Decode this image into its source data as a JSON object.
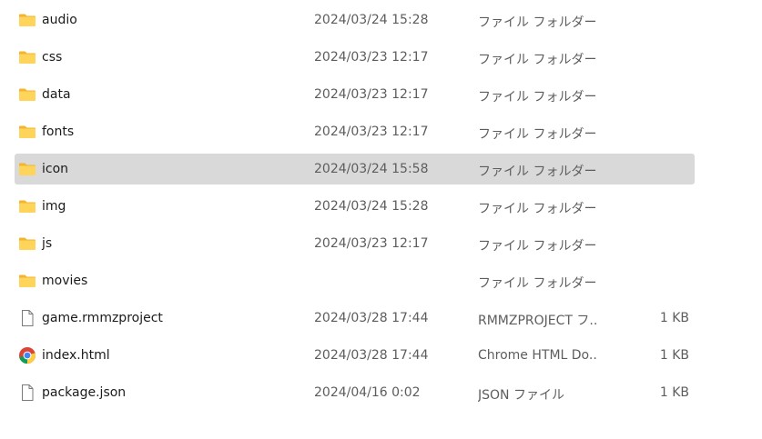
{
  "colors": {
    "folder": "#ffd45a",
    "folder_tab": "#f2b52b",
    "selected_row": "#d9d9d9",
    "secondary_text": "#5d5d5d"
  },
  "files": [
    {
      "name": "audio",
      "date": "2024/03/24 15:28",
      "type": "ファイル フォルダー",
      "size": "",
      "icon": "folder-icon"
    },
    {
      "name": "css",
      "date": "2024/03/23 12:17",
      "type": "ファイル フォルダー",
      "size": "",
      "icon": "folder-icon"
    },
    {
      "name": "data",
      "date": "2024/03/23 12:17",
      "type": "ファイル フォルダー",
      "size": "",
      "icon": "folder-icon"
    },
    {
      "name": "fonts",
      "date": "2024/03/23 12:17",
      "type": "ファイル フォルダー",
      "size": "",
      "icon": "folder-icon"
    },
    {
      "name": "icon",
      "date": "2024/03/24 15:58",
      "type": "ファイル フォルダー",
      "size": "",
      "icon": "folder-icon",
      "selected": true
    },
    {
      "name": "img",
      "date": "2024/03/24 15:28",
      "type": "ファイル フォルダー",
      "size": "",
      "icon": "folder-icon"
    },
    {
      "name": "js",
      "date": "2024/03/23 12:17",
      "type": "ファイル フォルダー",
      "size": "",
      "icon": "folder-icon"
    },
    {
      "name": "movies",
      "date": "",
      "type": "ファイル フォルダー",
      "size": "",
      "icon": "folder-icon"
    },
    {
      "name": "game.rmmzproject",
      "date": "2024/03/28 17:44",
      "type": "RMMZPROJECT フ...",
      "size": "1 KB",
      "icon": "document-icon"
    },
    {
      "name": "index.html",
      "date": "2024/03/28 17:44",
      "type": "Chrome HTML Do...",
      "size": "1 KB",
      "icon": "chrome-icon"
    },
    {
      "name": "package.json",
      "date": "2024/04/16 0:02",
      "type": "JSON ファイル",
      "size": "1 KB",
      "icon": "document-icon"
    }
  ]
}
